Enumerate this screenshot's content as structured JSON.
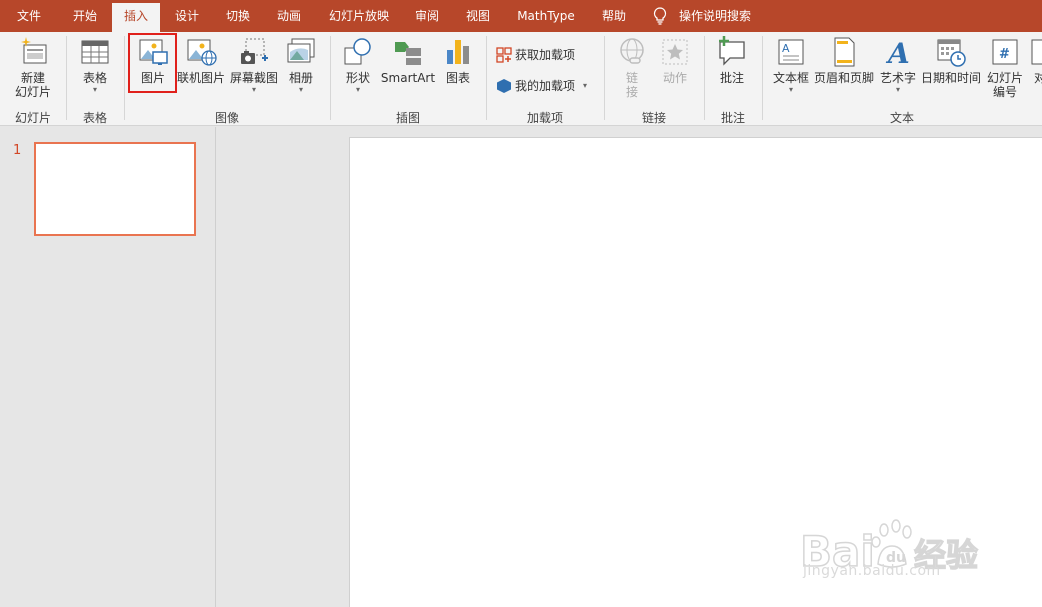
{
  "tabs": {
    "file": "文件",
    "home": "开始",
    "insert": "插入",
    "design": "设计",
    "transitions": "切换",
    "animations": "动画",
    "slideshow": "幻灯片放映",
    "review": "审阅",
    "view": "视图",
    "mathtype": "MathType",
    "help": "帮助",
    "tell_me": "操作说明搜索"
  },
  "ribbon": {
    "slides": {
      "new_slide_line1": "新建",
      "new_slide_line2": "幻灯片",
      "group": "幻灯片"
    },
    "tables": {
      "table": "表格",
      "group": "表格"
    },
    "images": {
      "picture": "图片",
      "online_picture": "联机图片",
      "screenshot": "屏幕截图",
      "album": "相册",
      "group": "图像"
    },
    "illustrations": {
      "shapes": "形状",
      "smartart": "SmartArt",
      "chart": "图表",
      "group": "插图"
    },
    "addins": {
      "get_addins": "获取加载项",
      "my_addins": "我的加载项",
      "group": "加载项"
    },
    "links": {
      "link_line1": "链",
      "link_line2": "接",
      "action": "动作",
      "group": "链接"
    },
    "comments": {
      "comment": "批注",
      "group": "批注"
    },
    "text": {
      "textbox": "文本框",
      "header_footer": "页眉和页脚",
      "wordart": "艺术字",
      "datetime": "日期和时间",
      "slide_number_line1": "幻灯片",
      "slide_number_line2": "编号",
      "object_partial": "对",
      "group": "文本"
    }
  },
  "slides_panel": {
    "slide_number": "1"
  },
  "watermark": {
    "brand_text": "Bai 经验",
    "url": "jingyan.baidu.com"
  },
  "colors": {
    "accent": "#b7472a",
    "highlight_box": "#e0201b",
    "thumb_border": "#e97450"
  }
}
